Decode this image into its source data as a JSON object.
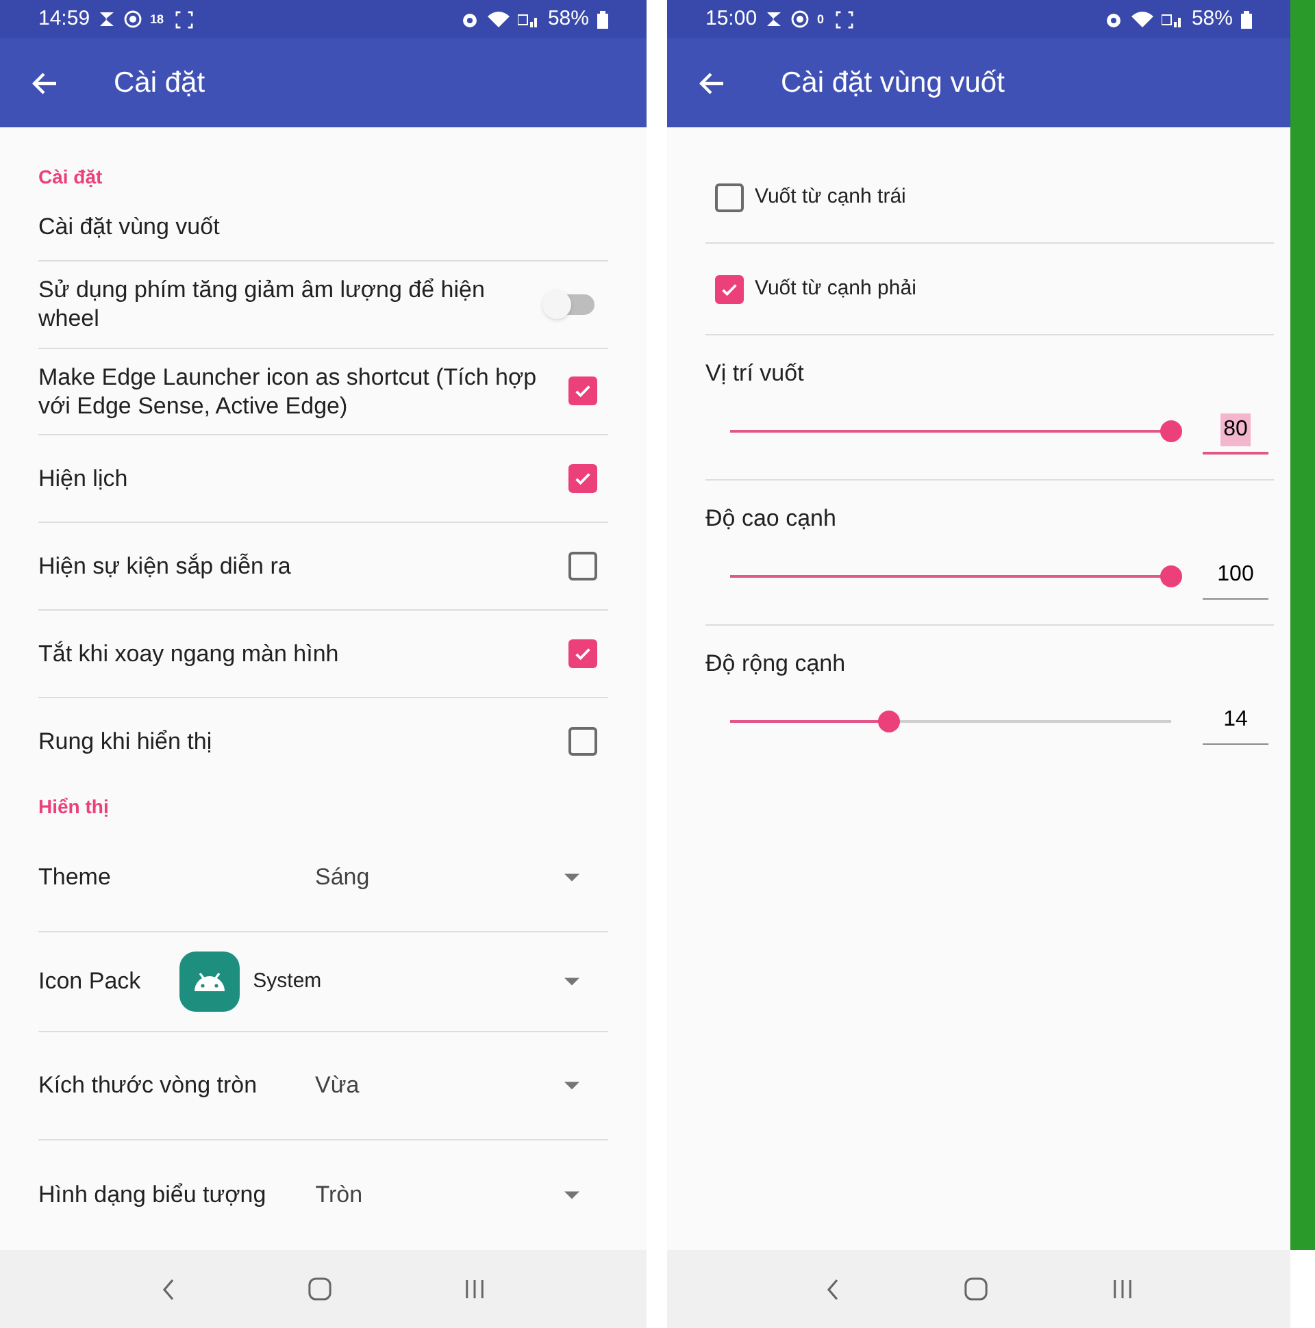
{
  "screens": [
    {
      "status_bar": {
        "time": "14:59",
        "speed": "18",
        "battery": "58%"
      },
      "app_bar": {
        "title": "Cài đặt"
      },
      "items": [
        {
          "kind": "header",
          "label": "Cài đặt"
        },
        {
          "kind": "plain",
          "label": "Cài đặt vùng vuốt"
        },
        {
          "kind": "switch",
          "label": "Sử dụng phím tăng giảm âm lượng để hiện wheel",
          "on": false
        },
        {
          "kind": "checkbox",
          "label": "Make Edge Launcher icon as shortcut (Tích hợp với Edge Sense, Active Edge)",
          "checked": true
        },
        {
          "kind": "checkbox",
          "label": "Hiện lịch",
          "checked": true
        },
        {
          "kind": "checkbox",
          "label": "Hiện sự kiện sắp diễn ra",
          "checked": false
        },
        {
          "kind": "checkbox",
          "label": "Tắt khi xoay ngang màn hình",
          "checked": true
        },
        {
          "kind": "checkbox",
          "label": "Rung khi hiển thị",
          "checked": false
        },
        {
          "kind": "header",
          "label": "Hiển thị"
        },
        {
          "kind": "dropdown",
          "label": "Theme",
          "value": "Sáng"
        },
        {
          "kind": "dropdown_icon",
          "label": "Icon Pack",
          "value": "System"
        },
        {
          "kind": "dropdown",
          "label": "Kích thước vòng tròn",
          "value": "Vừa"
        },
        {
          "kind": "dropdown",
          "label": "Hình dạng biểu tượng",
          "value": "Tròn"
        }
      ]
    },
    {
      "status_bar": {
        "time": "15:00",
        "speed": "0",
        "battery": "58%"
      },
      "app_bar": {
        "title": "Cài đặt vùng vuốt"
      },
      "items": [
        {
          "kind": "checkbox_left",
          "label": "Vuốt từ cạnh trái",
          "checked": false
        },
        {
          "kind": "checkbox_left",
          "label": "Vuốt từ cạnh phải",
          "checked": true
        },
        {
          "kind": "slider",
          "label": "Vị trí vuốt",
          "level": 1,
          "value": "80",
          "focused": true
        },
        {
          "kind": "slider",
          "label": "Độ cao cạnh",
          "level": 1,
          "value": "100",
          "focused": false
        },
        {
          "kind": "slider",
          "label": "Độ rộng cạnh",
          "level": 0.36,
          "value": "14",
          "focused": false
        }
      ]
    }
  ]
}
